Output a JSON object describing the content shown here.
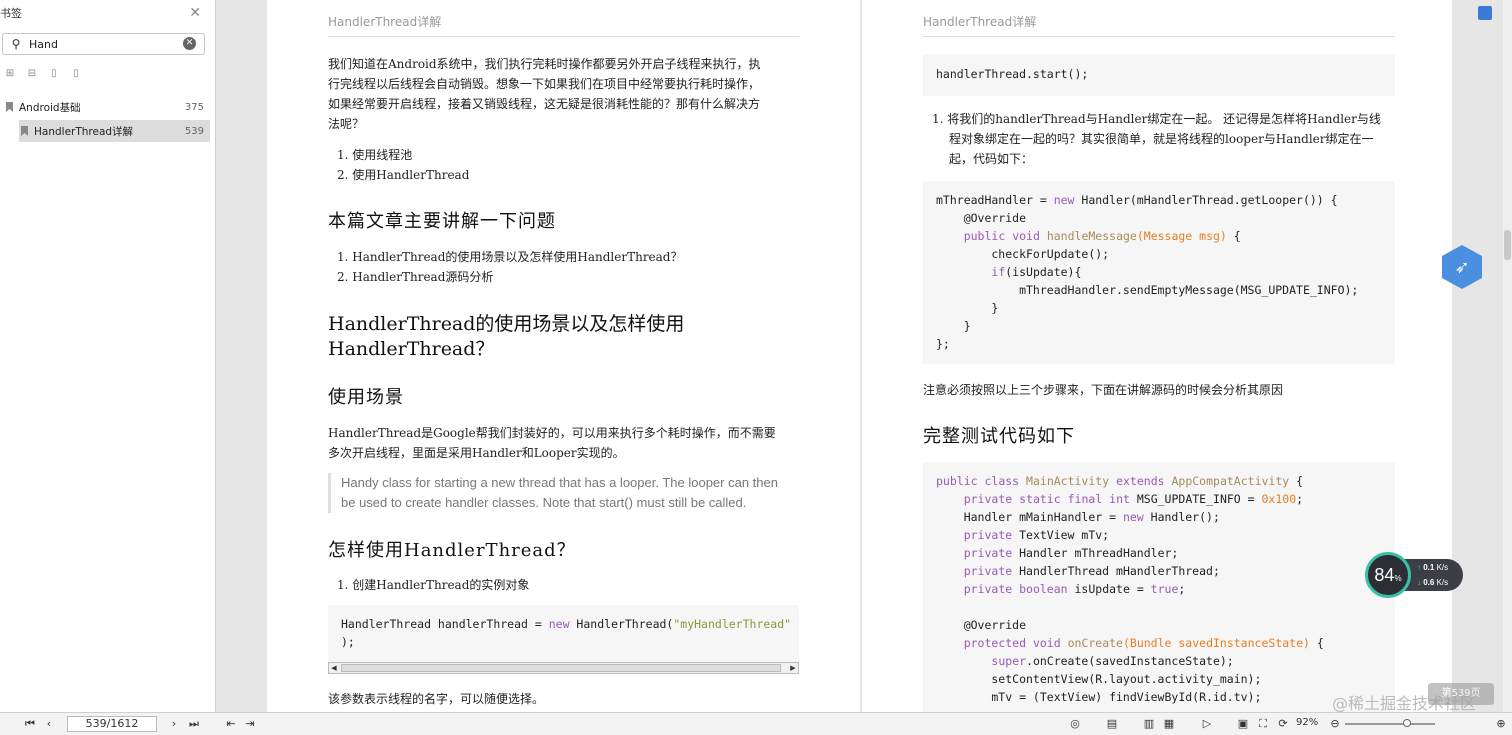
{
  "sidebar": {
    "title": "书签",
    "search_value": "Hand",
    "items": [
      {
        "label": "Android基础",
        "page": "375"
      },
      {
        "label": "HandlerThread详解",
        "page": "539"
      }
    ]
  },
  "left_page": {
    "header": "HandlerThread详解",
    "intro": [
      "我们知道在Android系统中，我们执行完耗时操作都要另外开启子线程来执行，执",
      "行完线程以后线程会自动销毁。想象一下如果我们在项目中经常要执行耗时操作，",
      "如果经常要开启线程，接着又销毁线程，这无疑是很消耗性能的？那有什么解决方",
      "法呢？"
    ],
    "solutions": [
      "1. 使用线程池",
      "2. 使用HandlerThread"
    ],
    "h_questions": "本篇文章主要讲解一下问题",
    "questions": [
      "1. HandlerThread的使用场景以及怎样使用HandlerThread？",
      "2. HandlerThread源码分析"
    ],
    "h_main_1": "HandlerThread的使用场景以及怎样使用",
    "h_main_2": "HandlerThread？",
    "h_scene": "使用场景",
    "scene_text": [
      "HandlerThread是Google帮我们封装好的，可以用来执行多个耗时操作，而不需要",
      "多次开启线程，里面是采用Handler和Looper实现的。"
    ],
    "quote": [
      "Handy class for starting a new thread that has a looper. The looper can then",
      "be used to create handler classes. Note that start() must still be called."
    ],
    "h_how": "怎样使用HandlerThread？",
    "step1": "1. 创建HandlerThread的实例对象",
    "code1_a": "HandlerThread handlerThread = ",
    "code1_new": "new",
    "code1_b": " HandlerThread(",
    "code1_str": "\"myHandlerThread\"",
    "code1_c": ");",
    "param_note": "该参数表示线程的名字，可以随便选择。"
  },
  "right_page": {
    "header": "HandlerThread详解",
    "code_start": "handlerThread.start();",
    "bind_text": [
      "1. 将我们的handlerThread与Handler绑定在一起。 还记得是怎样将Handler与线",
      "程对象绑定在一起的吗？其实很简单，就是将线程的looper与Handler绑定在一",
      "起，代码如下："
    ],
    "note": "注意必须按照以上三个步骤来，下面在讲解源码的时候会分析其原因",
    "h_full": "完整测试代码如下"
  },
  "overlay": {
    "cpu_percent": "84",
    "cpu_unit": "%",
    "up_speed": "0.1",
    "down_speed": "0.6",
    "speed_unit": "K/s",
    "watermark": "@稀土掘金技术社区",
    "wm_button": "第539页"
  },
  "bottombar": {
    "page_indicator": "539/1612",
    "zoom": "92%"
  }
}
